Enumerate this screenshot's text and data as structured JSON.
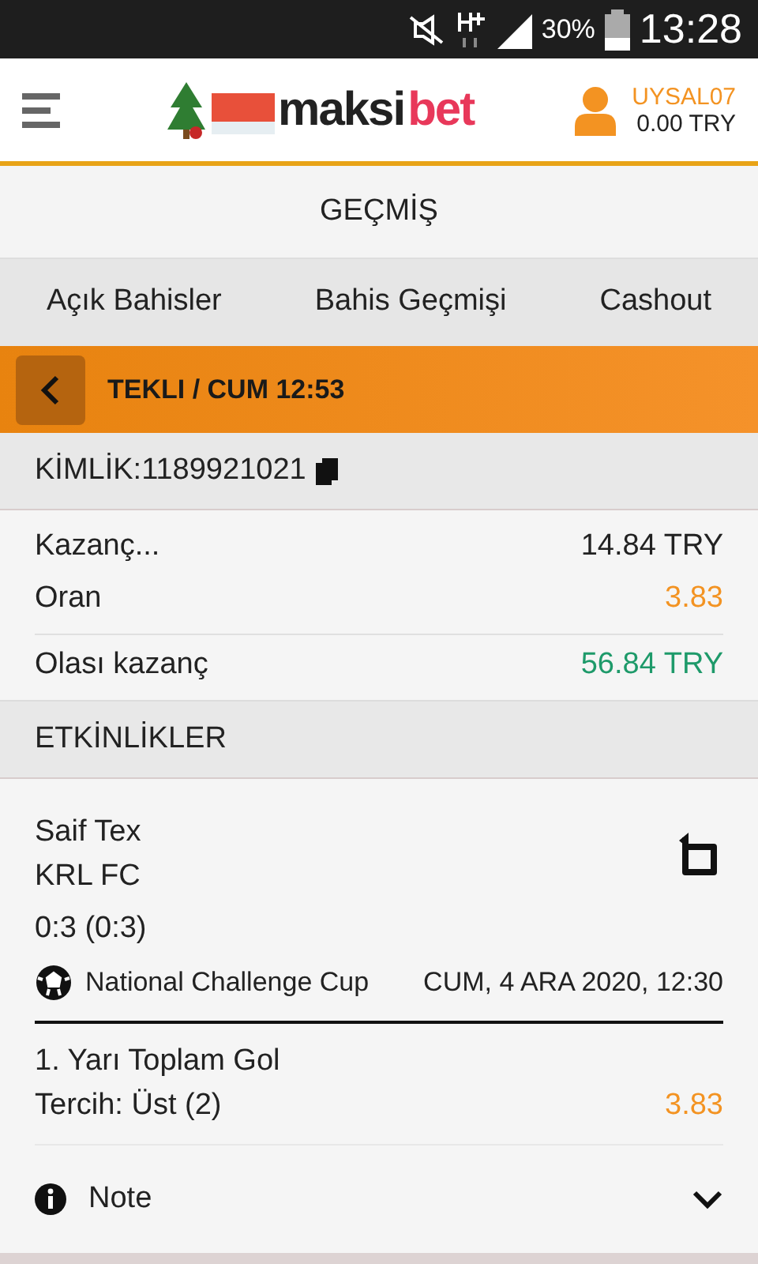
{
  "status_bar": {
    "battery": "30%",
    "time": "13:28"
  },
  "header": {
    "logo": {
      "part_1": "maksi",
      "part_2": "bet"
    },
    "user": {
      "name": "UYSAL07",
      "balance": "0.00 TRY"
    }
  },
  "page_title": "GEÇMİŞ",
  "tabs": [
    {
      "label": "Açık Bahisler"
    },
    {
      "label": "Bahis Geçmişi"
    },
    {
      "label": "Cashout"
    }
  ],
  "bet_bar": {
    "title": "TEKLI / CUM 12:53"
  },
  "bet_id": "KİMLİK:1189921021",
  "summary": [
    {
      "label": "Kazanç...",
      "value": "14.84 TRY",
      "kind": "plain"
    },
    {
      "label": "Oran",
      "value": "3.83",
      "kind": "odds"
    },
    {
      "label": "Olası kazanç",
      "value": "56.84 TRY",
      "kind": "win"
    }
  ],
  "events_title": "ETKİNLİKLER",
  "event": {
    "home": "Saif Tex",
    "away": "KRL FC",
    "score": "0:3 (0:3)",
    "league": "National Challenge Cup",
    "date": "CUM, 4 ARA 2020, 12:30",
    "market": "1. Yarı Toplam Gol",
    "pick": "Tercih: Üst (2)",
    "odds": "3.83"
  },
  "note": {
    "label": "Note",
    "expanded": false
  }
}
